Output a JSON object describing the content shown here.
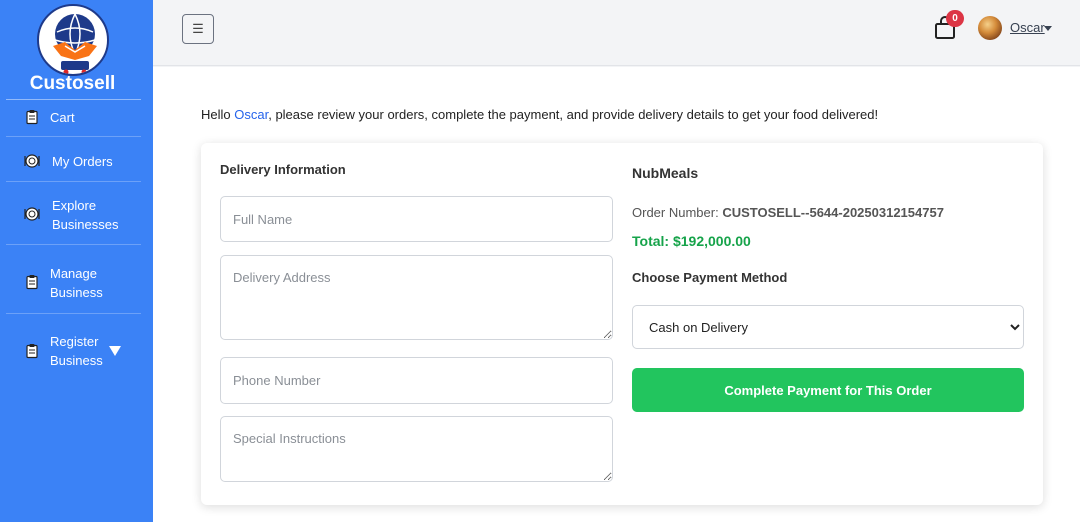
{
  "sidebar": {
    "brand": "Custosell",
    "items": [
      {
        "label": "Cart",
        "icon": "clipboard-icon"
      },
      {
        "label": "My Orders",
        "icon": "plate-icon"
      },
      {
        "label": "Explore Businesses",
        "icon": "plate-icon"
      },
      {
        "label": "Manage Business",
        "icon": "clipboard-icon"
      },
      {
        "label": "Register Business",
        "icon": "clipboard-icon"
      }
    ]
  },
  "topbar": {
    "toggle_icon": "☰",
    "cart_count": "0",
    "user_name": "Oscar"
  },
  "main": {
    "greeting_prefix": "Hello ",
    "greeting_name": "Oscar",
    "greeting_suffix": ", please review your orders, complete the payment, and provide delivery details to get your food delivered!"
  },
  "delivery": {
    "title": "Delivery Information",
    "full_name_placeholder": "Full Name",
    "address_placeholder": "Delivery Address",
    "phone_placeholder": "Phone Number",
    "instructions_placeholder": "Special Instructions"
  },
  "order": {
    "merchant": "NubMeals",
    "number_label": "Order Number: ",
    "number_value": "CUSTOSELL--5644-20250312154757",
    "total_label": "Total: ",
    "total_value": "$192,000.00",
    "payment_title": "Choose Payment Method",
    "payment_selected": "Cash on Delivery",
    "submit_label": "Complete Payment for This Order"
  },
  "colors": {
    "sidebar": "#3b82f6",
    "accent_link": "#2563eb",
    "success": "#22c55e",
    "total": "#16a34a",
    "badge": "#dc3545"
  }
}
